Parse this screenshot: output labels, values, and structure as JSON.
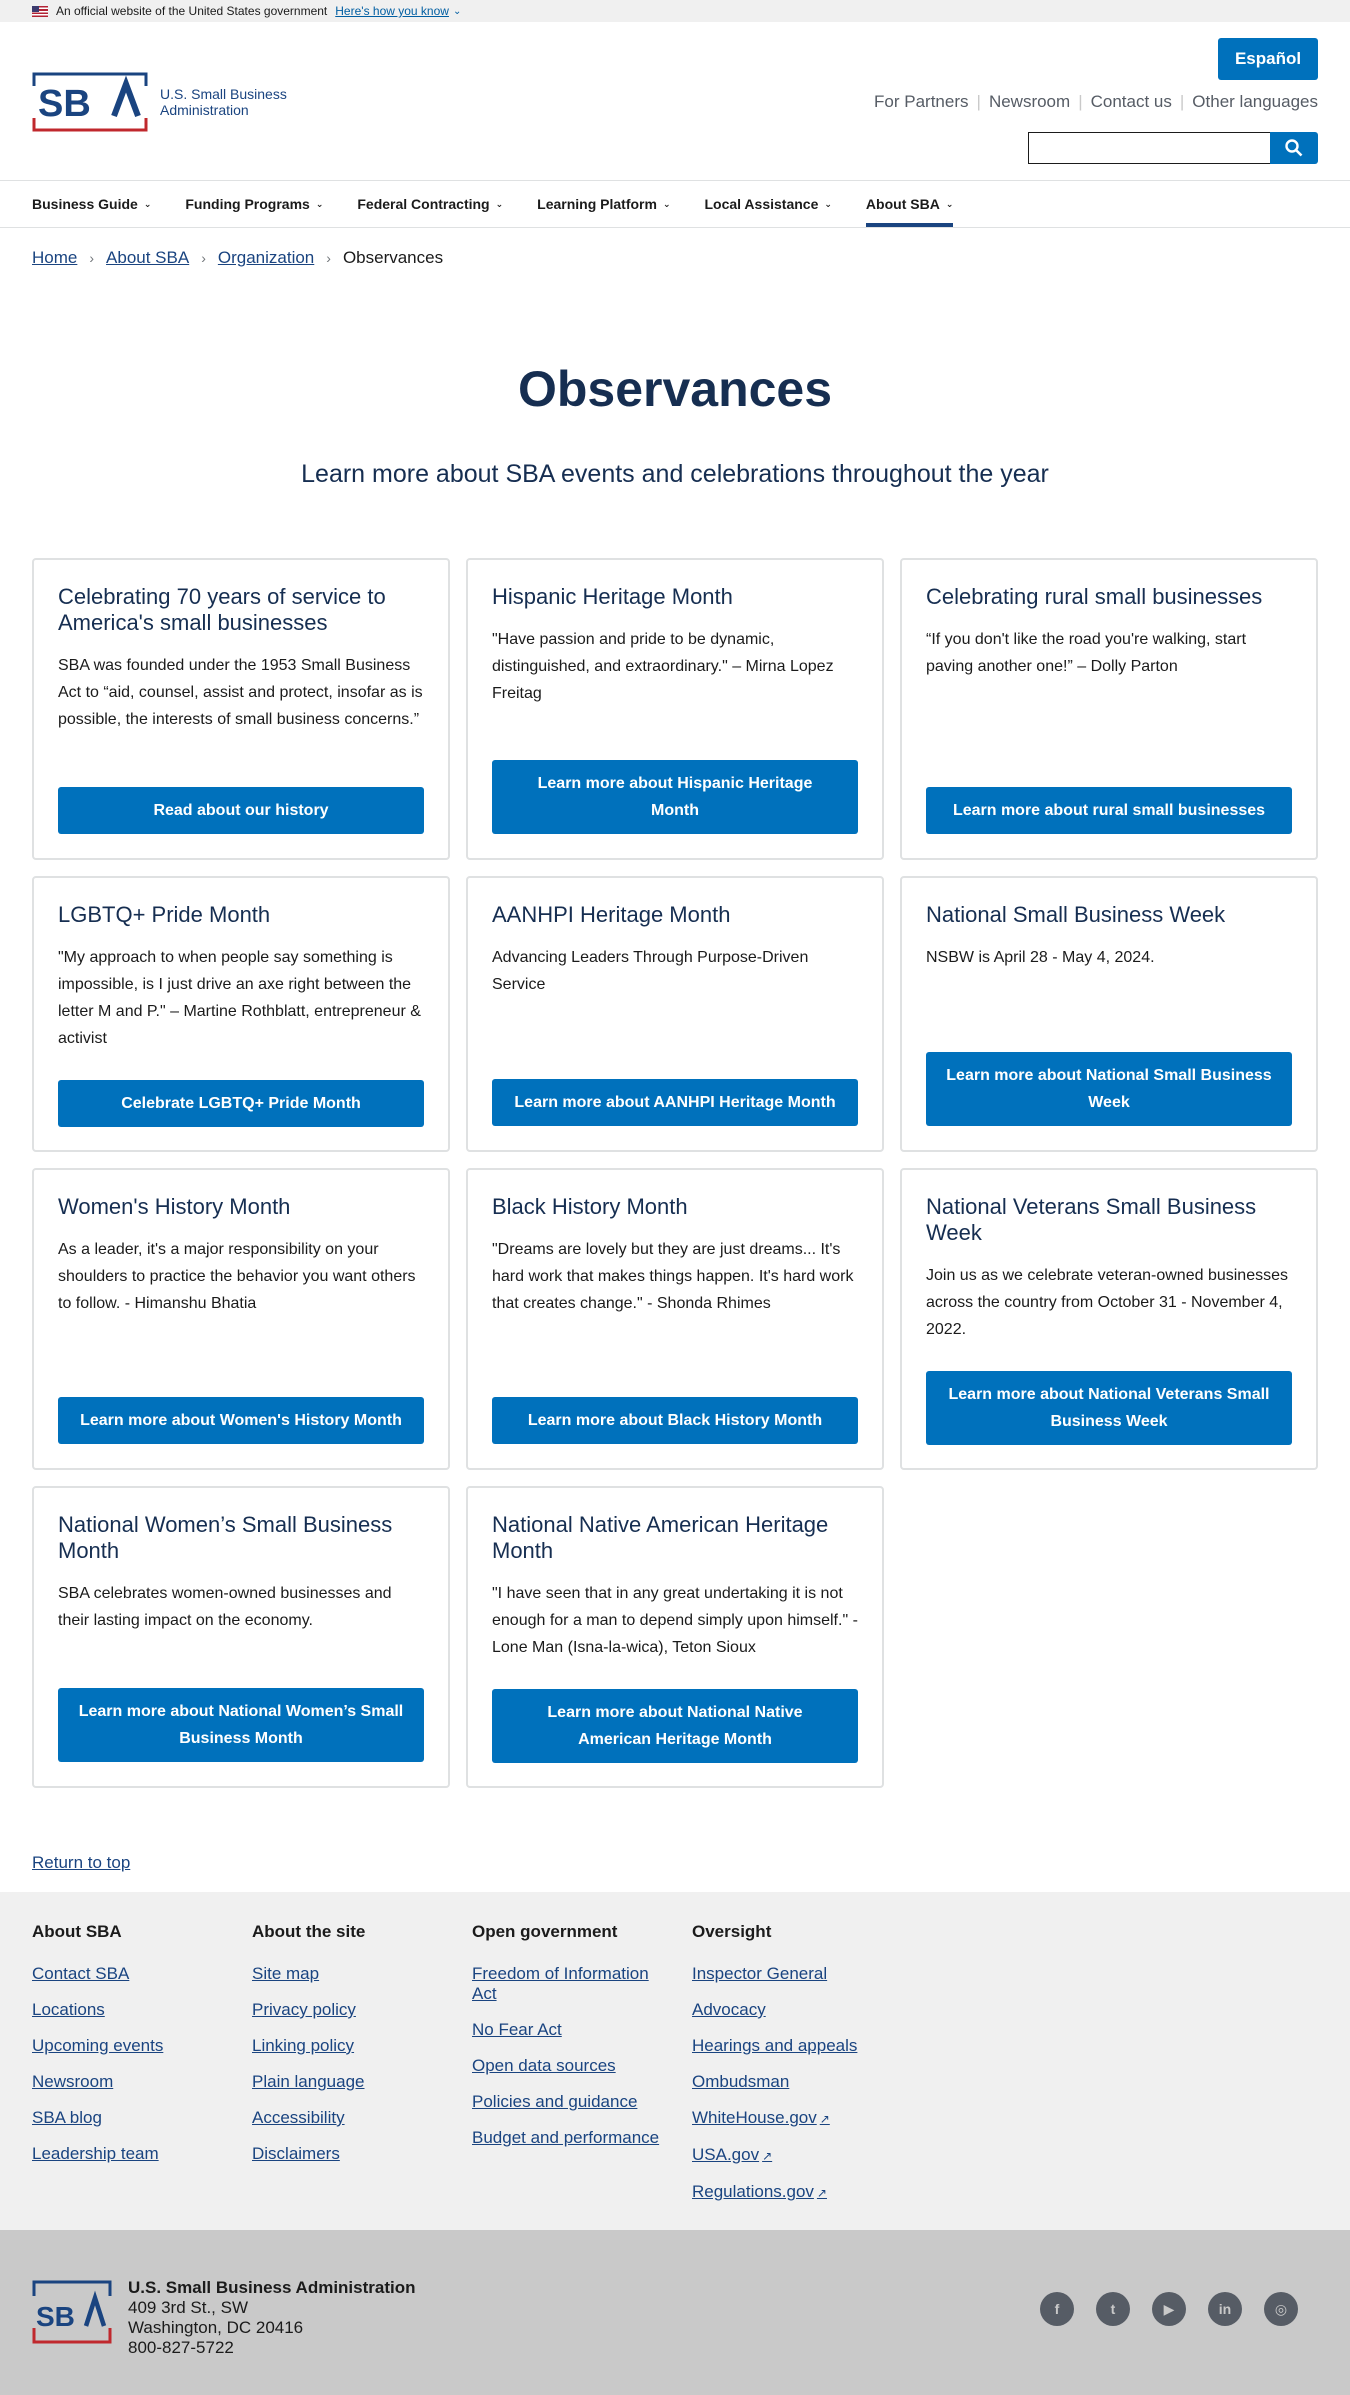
{
  "banner": {
    "text": "An official website of the United States government",
    "link": "Here's how you know"
  },
  "header": {
    "logo_line1": "U.S. Small Business",
    "logo_line2": "Administration",
    "espanol": "Español",
    "util_links": [
      "For Partners",
      "Newsroom",
      "Contact us",
      "Other languages"
    ]
  },
  "nav": [
    "Business Guide",
    "Funding Programs",
    "Federal Contracting",
    "Learning Platform",
    "Local Assistance",
    "About SBA"
  ],
  "breadcrumb": [
    "Home",
    "About SBA",
    "Organization",
    "Observances"
  ],
  "page": {
    "title": "Observances",
    "subtitle": "Learn more about SBA events and celebrations throughout the year"
  },
  "cards": [
    {
      "title": "Celebrating 70 years of service to America's small businesses",
      "body": "SBA was founded under the 1953 Small Business Act to “aid, counsel, assist and protect, insofar as is possible, the interests of small business concerns.”",
      "button": "Read about our history"
    },
    {
      "title": "Hispanic Heritage Month",
      "body": "\"Have passion and pride to be dynamic, distinguished, and extraordinary.\" – Mirna Lopez Freitag",
      "button": "Learn more about Hispanic Heritage Month"
    },
    {
      "title": "Celebrating rural small businesses",
      "body": "“If you don't like the road you're walking, start paving another one!” – Dolly Parton",
      "button": "Learn more about rural small businesses"
    },
    {
      "title": "LGBTQ+ Pride Month",
      "body": "\"My approach to when people say something is impossible, is I just drive an axe right between the letter M and P.\" – Martine Rothblatt, entrepreneur & activist",
      "button": "Celebrate LGBTQ+ Pride Month"
    },
    {
      "title": "AANHPI Heritage Month",
      "body": "Advancing Leaders Through Purpose-Driven Service",
      "button": "Learn more about AANHPI Heritage Month"
    },
    {
      "title": "National Small Business Week",
      "body": "NSBW is April 28 - May 4, 2024.",
      "button": "Learn more about National Small Business Week"
    },
    {
      "title": "Women's History Month",
      "body": "As a leader, it's a major responsibility on your shoulders to practice the behavior you want others to follow. - Himanshu Bhatia",
      "button": "Learn more about Women's History Month"
    },
    {
      "title": "Black History Month",
      "body": "\"Dreams are lovely but they are just dreams... It's hard work that makes things happen. It's hard work that creates change.\" - Shonda Rhimes",
      "button": "Learn more about Black History Month"
    },
    {
      "title": "National Veterans Small Business Week",
      "body": "Join us as we celebrate veteran-owned businesses across the country from October 31 - November 4, 2022.",
      "button": "Learn more about National Veterans Small Business Week"
    },
    {
      "title": "National Women’s Small Business Month",
      "body": "SBA celebrates women-owned businesses and their lasting impact on the economy.",
      "button": "Learn more about National Women’s Small Business Month"
    },
    {
      "title": "National Native American Heritage Month",
      "body": "\"I have seen that in any great undertaking it is not enough for a man to depend simply upon himself.\" - Lone Man (Isna-la-wica), Teton Sioux",
      "button": "Learn more about National Native American Heritage Month"
    }
  ],
  "return_top": "Return to top",
  "footer": {
    "columns": [
      {
        "heading": "About SBA",
        "links": [
          "Contact SBA",
          "Locations",
          "Upcoming events",
          "Newsroom",
          "SBA blog",
          "Leadership team"
        ]
      },
      {
        "heading": "About the site",
        "links": [
          "Site map",
          "Privacy policy",
          "Linking policy",
          "Plain language",
          "Accessibility",
          "Disclaimers"
        ]
      },
      {
        "heading": "Open government",
        "links": [
          "Freedom of Information Act",
          "No Fear Act",
          "Open data sources",
          "Policies and guidance",
          "Budget and performance"
        ]
      },
      {
        "heading": "Oversight",
        "links": [
          "Inspector General",
          "Advocacy",
          "Hearings and appeals",
          "Ombudsman",
          "WhiteHouse.gov",
          "USA.gov",
          "Regulations.gov"
        ]
      }
    ],
    "address": {
      "org": "U.S. Small Business Administration",
      "street": "409 3rd St., SW",
      "city": "Washington, DC 20416",
      "phone": "800-827-5722"
    },
    "social": [
      "facebook-icon",
      "twitter-icon",
      "youtube-icon",
      "linkedin-icon",
      "instagram-icon"
    ]
  },
  "colors": {
    "primary": "#0071bc",
    "navy": "#162e51",
    "link": "#1a4480",
    "footer_bg": "#f0f0f0",
    "footer_bottom_bg": "#c9c9c9"
  }
}
